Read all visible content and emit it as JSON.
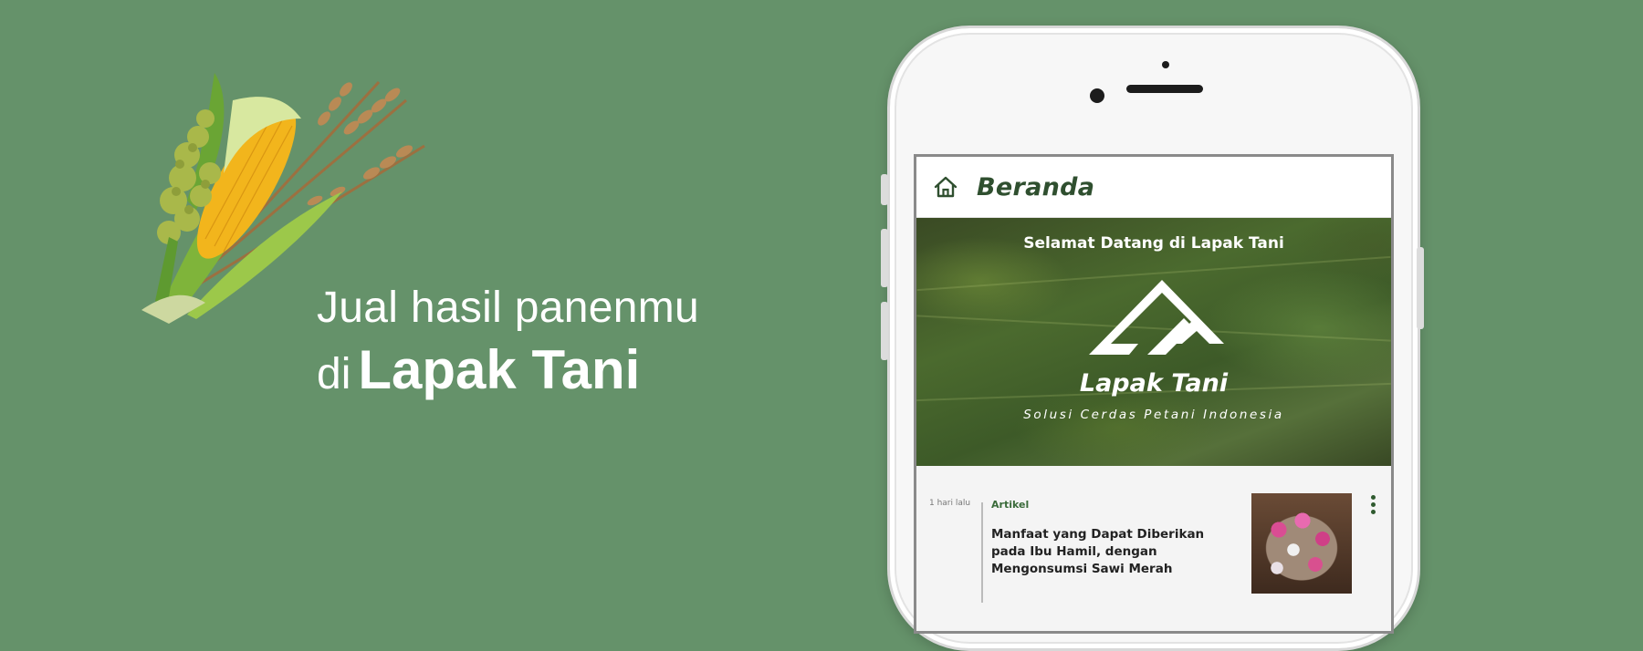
{
  "hero": {
    "tagline_line1": "Jual hasil panenmu",
    "tagline_prefix": "di",
    "tagline_brand": "Lapak Tani",
    "illustration_icon": "grain-bundle-icon"
  },
  "app": {
    "header": {
      "home_icon": "home-icon",
      "title": "Beranda"
    },
    "banner": {
      "welcome": "Selamat Datang di Lapak Tani",
      "logo_icon": "lapak-tani-logo-icon",
      "brand": "Lapak Tani",
      "slogan": "Solusi Cerdas Petani Indonesia"
    },
    "feed": [
      {
        "time": "1 hari lalu",
        "category": "Artikel",
        "title": "Manfaat yang Dapat Diberikan pada Ibu Hamil, dengan Mengonsumsi Sawi Merah",
        "more_icon": "more-vertical-icon"
      }
    ]
  },
  "colors": {
    "background": "#65926A",
    "brand_green": "#2f4f2f",
    "category_green": "#3a6b3a"
  }
}
